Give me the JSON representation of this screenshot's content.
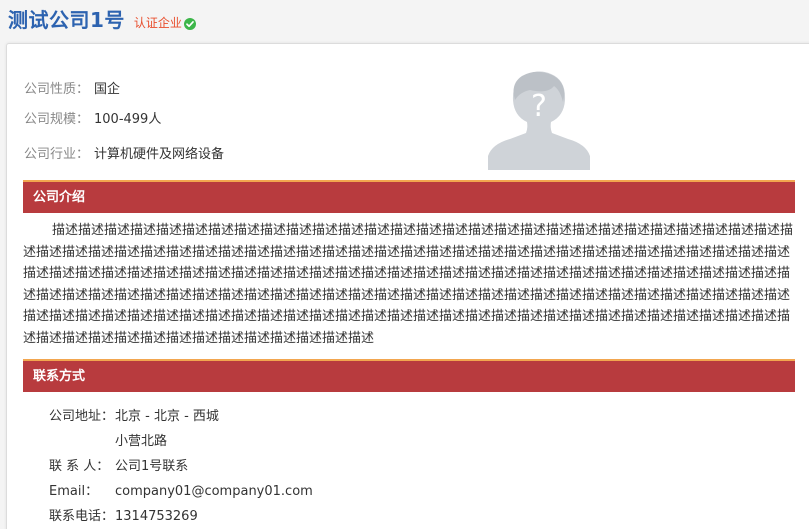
{
  "header": {
    "company_name": "测试公司1号",
    "verified_label": "认证企业",
    "verified_icon": "check-circle-icon",
    "verified_color": "#3cb649"
  },
  "basic_info": [
    {
      "label": "公司性质：",
      "value": "国企"
    },
    {
      "label": "公司规模：",
      "value": "100-499人"
    },
    {
      "label": "公司行业：",
      "value": "计算机硬件及网络设备"
    }
  ],
  "avatar_icon": "unknown-user-avatar-icon",
  "intro": {
    "title": "公司介绍",
    "text": "描述描述描述描述描述描述描述描述描述描述描述描述描述描述描述描述描述描述描述描述描述描述描述描述描述描述描述描述描述描述描述描述描述描述描述描述描述描述描述描述描述描述描述描述描述描述描述描述描述描述描述描述描述描述描述描述描述描述描述描述描述描述描述描述描述描述描述描述描述描述描述描述描述描述描述描述描述描述描述描述描述描述描述描述描述描述描述描述描述描述描述描述描述描述描述描述描述描述描述描述描述描述描述描述描述描述描述描述描述描述描述描述描述描述描述描述描述描述描述描述描述描述描述描述描述描述描述描述描述描述描述描述描述描述描述描述描述描述描述描述描述描述描述描述描述描述描述描述描述描述描述描述描述描述描述描述描述描述描述描述"
  },
  "contact": {
    "title": "联系方式",
    "address_label": "公司地址：",
    "address_line1": "北京 - 北京 - 西城",
    "address_line2": "小营北路",
    "person_label": "联 系 人：",
    "person": "公司1号联系",
    "email_label": "Email：",
    "email": "company01@company01.com",
    "phone_label": "联系电话：",
    "phone": "1314753269"
  },
  "colors": {
    "brand_blue": "#2d63b0",
    "section_red": "#b83b3e",
    "section_accent": "#f2a64f",
    "verify_orange": "#e84d2c"
  }
}
